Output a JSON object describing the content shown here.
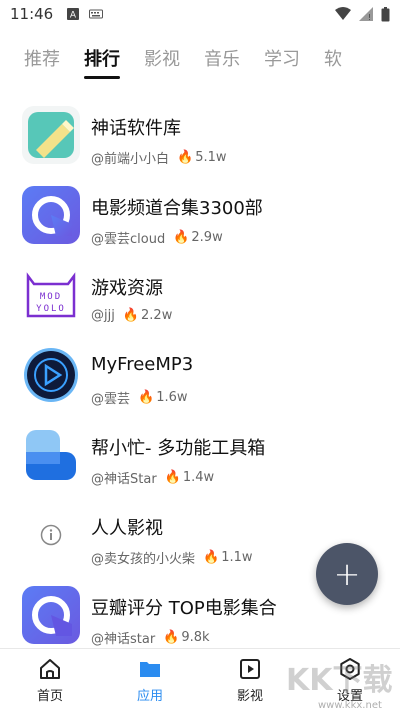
{
  "status": {
    "time": "11:46"
  },
  "tabs": [
    {
      "label": "推荐"
    },
    {
      "label": "排行"
    },
    {
      "label": "影视"
    },
    {
      "label": "音乐"
    },
    {
      "label": "学习"
    },
    {
      "label": "软"
    }
  ],
  "items": [
    {
      "title": "神话软件库",
      "author": "@前端小小白",
      "hot": "5.1w"
    },
    {
      "title": "电影频道合集3300部",
      "author": "@雲芸cloud",
      "hot": "2.9w"
    },
    {
      "title": "游戏资源",
      "author": "@jjj",
      "hot": "2.2w",
      "logo_text_1": "MOD",
      "logo_text_2": "YOLO"
    },
    {
      "title": "MyFreeMP3",
      "author": "@雲芸",
      "hot": "1.6w"
    },
    {
      "title": "帮小忙- 多功能工具箱",
      "author": "@神话Star",
      "hot": "1.4w"
    },
    {
      "title": "人人影视",
      "author": "@卖女孩的小火柴",
      "hot": "1.1w"
    },
    {
      "title": "豆瓣评分 TOP电影集合",
      "author": "@神话star",
      "hot": "9.8k"
    }
  ],
  "fab": {
    "label": "+"
  },
  "bottom_nav": [
    {
      "label": "首页"
    },
    {
      "label": "应用"
    },
    {
      "label": "影视"
    },
    {
      "label": "设置"
    }
  ],
  "watermark": {
    "text": "KK下载",
    "url": "www.kkx.net"
  },
  "colors": {
    "accent": "#2b8cf0",
    "fab": "#4c5568",
    "fire": "#f08a24"
  }
}
